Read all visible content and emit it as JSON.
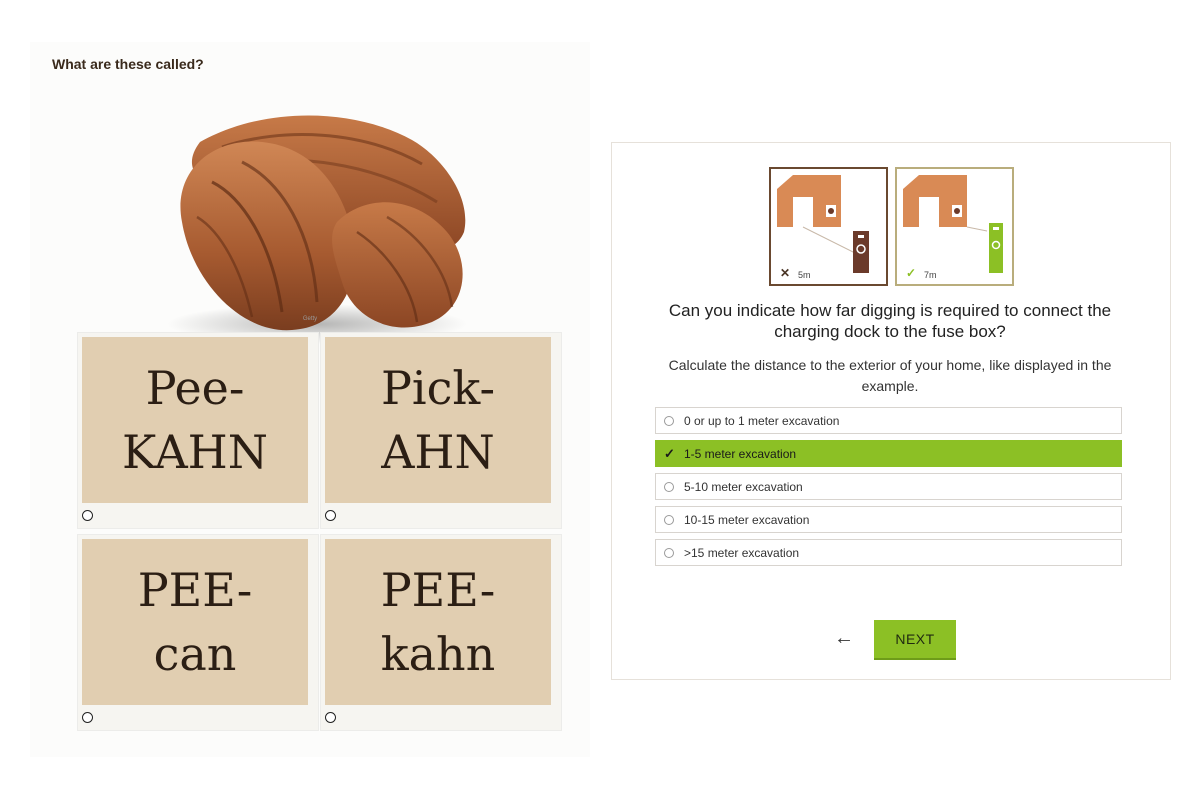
{
  "quiz": {
    "question": "What are these called?",
    "image": {
      "subject": "pecans",
      "credit": "Getty"
    },
    "options": [
      {
        "text": "Pee-\nKAHN",
        "selected": false
      },
      {
        "text": "Pick-\nAHN",
        "selected": false
      },
      {
        "text": "PEE-\ncan",
        "selected": false
      },
      {
        "text": "PEE-\nkahn",
        "selected": false
      }
    ]
  },
  "ev": {
    "examples": [
      {
        "mark": "✕",
        "distance": "5m",
        "status": "incorrect"
      },
      {
        "mark": "✓",
        "distance": "7m",
        "status": "correct"
      }
    ],
    "question": "Can you indicate how far digging is required to connect the charging dock to the fuse box?",
    "subtitle": "Calculate the distance to the exterior of your home, like displayed in the example.",
    "answers": [
      {
        "label": "0 or up to 1 meter excavation",
        "selected": false
      },
      {
        "label": "1-5 meter excavation",
        "selected": true
      },
      {
        "label": "5-10 meter excavation",
        "selected": false
      },
      {
        "label": "10-15 meter excavation",
        "selected": false
      },
      {
        "label": ">15 meter excavation",
        "selected": false
      }
    ],
    "back_label": "←",
    "next_label": "NEXT"
  },
  "colors": {
    "accent_green": "#8cc025",
    "card_tan": "#e1ceb1",
    "house_orange": "#d98a55",
    "fuse_brown": "#6b3a2a"
  }
}
